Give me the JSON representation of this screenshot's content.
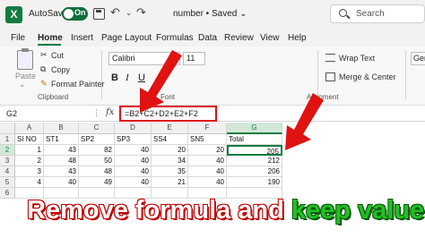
{
  "titlebar": {
    "app_icon": "X",
    "autosave_label": "AutoSave",
    "autosave_state": "On",
    "doc_title": "number • Saved",
    "doc_title_chevron": "⌄",
    "search_placeholder": "Search",
    "undo_icon": "↶",
    "redo_icon": "↷",
    "more_icon": "⌄"
  },
  "menu": [
    "File",
    "Home",
    "Insert",
    "Page Layout",
    "Formulas",
    "Data",
    "Review",
    "View",
    "Help"
  ],
  "menu_active": "Home",
  "ribbon": {
    "paste_label": "Paste",
    "cut_label": "Cut",
    "copy_label": "Copy",
    "format_painter_label": "Format Painter",
    "clipboard_group": "Clipboard",
    "font_name": "Calibri",
    "font_size": "11",
    "font_group": "Font",
    "bold": "B",
    "italic": "I",
    "underline": "U",
    "wrap_text_label": "Wrap Text",
    "merge_label": "Merge & Center",
    "alignment_group": "Alignment",
    "number_format": "Gene"
  },
  "formula_bar": {
    "name_box": "G2",
    "fx": "fx",
    "formula": "=B2+C2+D2+E2+F2"
  },
  "grid": {
    "columns": [
      "A",
      "B",
      "C",
      "D",
      "E",
      "F",
      "G"
    ],
    "rows": [
      "1",
      "2",
      "3",
      "4",
      "5",
      "6"
    ],
    "headers": [
      "SI NO",
      "ST1",
      "SP2",
      "SP3",
      "SS4",
      "SN5",
      "Total"
    ],
    "data": [
      [
        "1",
        "43",
        "82",
        "40",
        "20",
        "20",
        "205"
      ],
      [
        "2",
        "48",
        "50",
        "40",
        "34",
        "40",
        "212"
      ],
      [
        "3",
        "43",
        "48",
        "40",
        "35",
        "40",
        "206"
      ],
      [
        "4",
        "40",
        "49",
        "40",
        "21",
        "40",
        "190"
      ]
    ]
  },
  "banner": {
    "part1": "Remove formula and ",
    "part2": "keep value"
  },
  "colors": {
    "excel_green": "#107c41",
    "arrow_red": "#e01212",
    "banner_green": "#22c022"
  }
}
